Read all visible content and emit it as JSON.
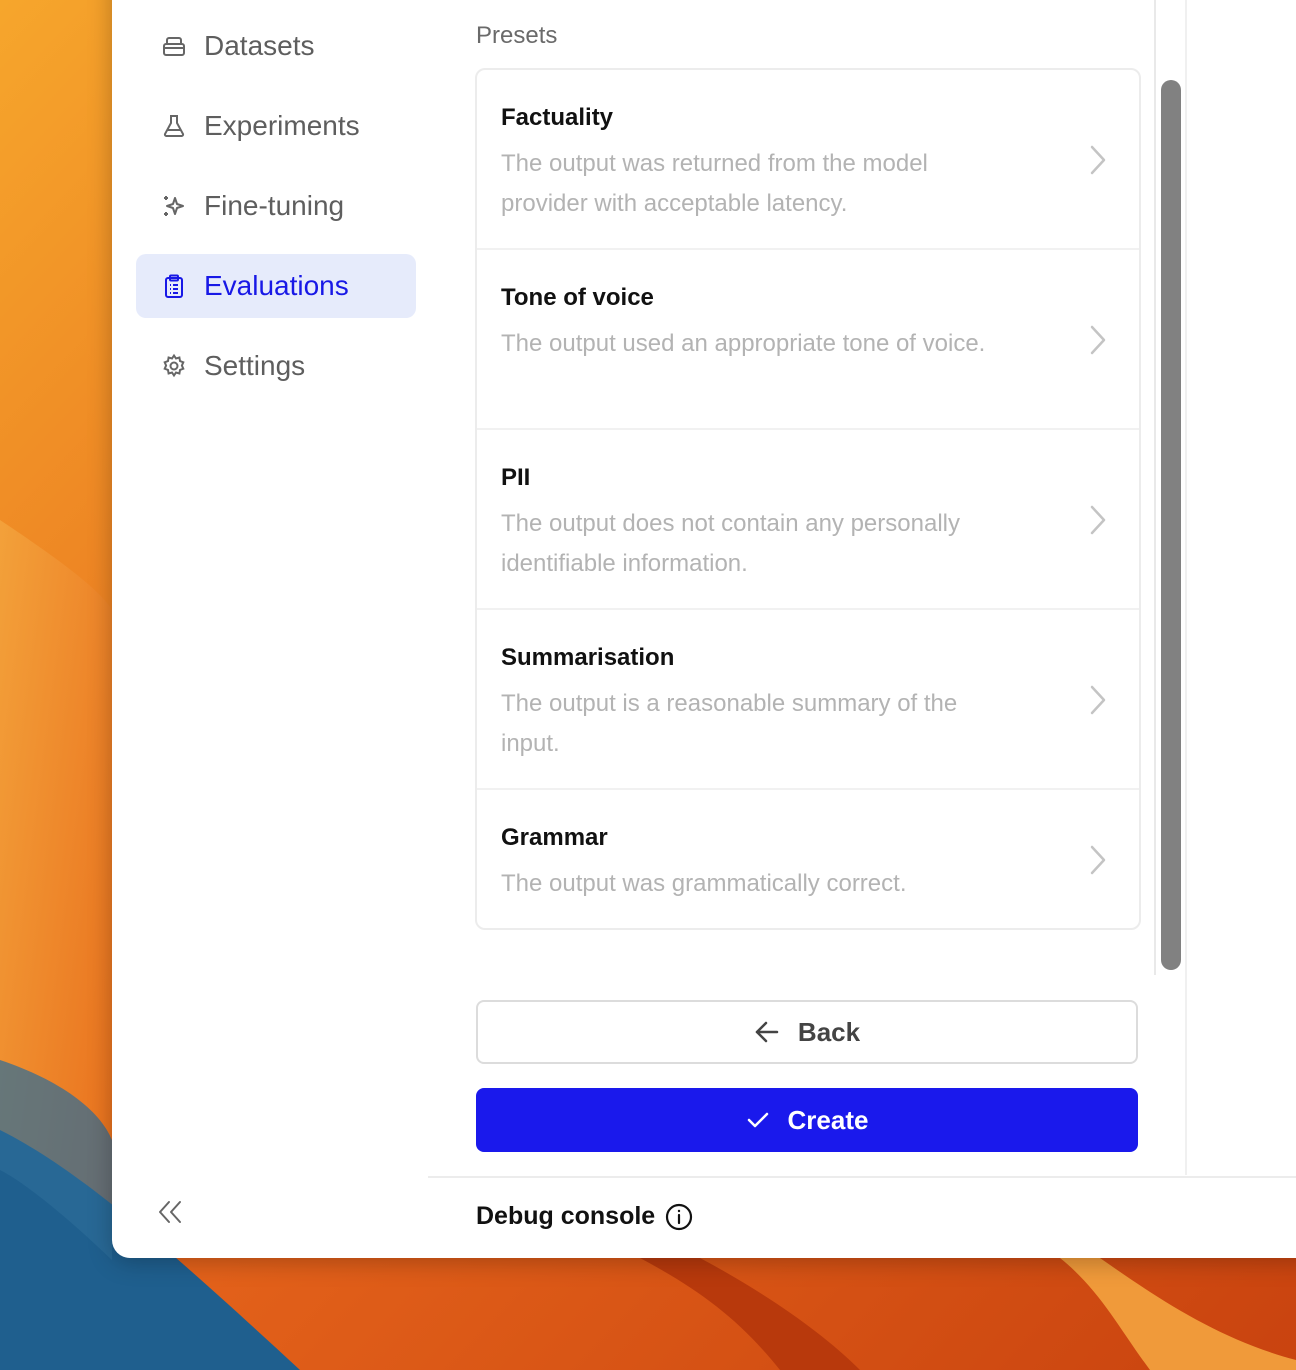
{
  "sidebar": {
    "items": [
      {
        "label": "Datasets",
        "icon": "database-icon",
        "active": false
      },
      {
        "label": "Experiments",
        "icon": "flask-icon",
        "active": false
      },
      {
        "label": "Fine-tuning",
        "icon": "sparkle-icon",
        "active": false
      },
      {
        "label": "Evaluations",
        "icon": "clipboard-icon",
        "active": true
      },
      {
        "label": "Settings",
        "icon": "gear-icon",
        "active": false
      }
    ],
    "collapse_icon": "double-chevron-left-icon"
  },
  "presets": {
    "title": "Presets",
    "items": [
      {
        "title": "Factuality",
        "description": "The output was returned from the model provider with acceptable latency."
      },
      {
        "title": "Tone of voice",
        "description": "The output used an appropriate tone of voice."
      },
      {
        "title": "PII",
        "description": "The output does not contain any personally identifiable information."
      },
      {
        "title": "Summarisation",
        "description": "The output is a reasonable summary of the input."
      },
      {
        "title": "Grammar",
        "description": "The output was grammatically correct."
      }
    ]
  },
  "actions": {
    "back_label": "Back",
    "create_label": "Create"
  },
  "footer": {
    "debug_label": "Debug console"
  },
  "colors": {
    "accent": "#1a19ec",
    "active_nav_bg": "#e6ebfb",
    "active_nav_text": "#1818e6"
  }
}
